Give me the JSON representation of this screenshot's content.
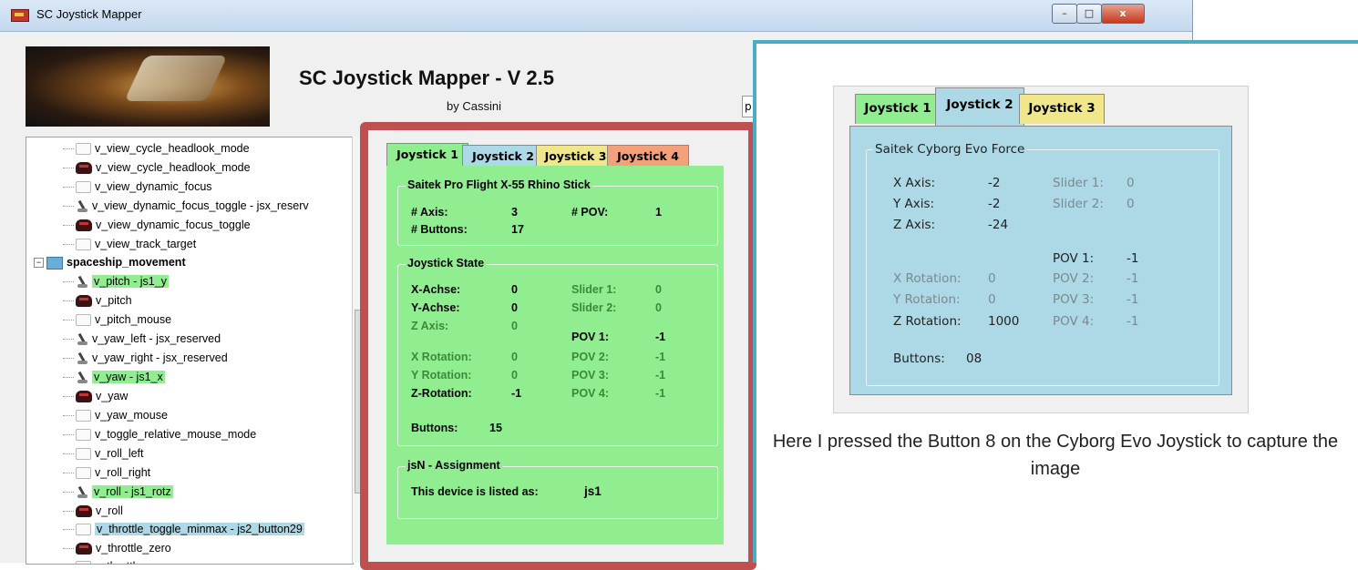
{
  "window": {
    "title": "SC Joystick Mapper",
    "controls": {
      "minimize": "–",
      "maximize": "□",
      "close": "x"
    }
  },
  "header": {
    "heading": "SC Joystick Mapper - V 2.5",
    "author": "by Cassini",
    "search_value": "p"
  },
  "tree": {
    "items": [
      {
        "label": "v_view_cycle_headlook_mode",
        "icon": "keyboard-icon"
      },
      {
        "label": "v_view_cycle_headlook_mode",
        "icon": "gamepad-icon"
      },
      {
        "label": "v_view_dynamic_focus",
        "icon": "keyboard-icon"
      },
      {
        "label": "v_view_dynamic_focus_toggle - jsx_reserv",
        "icon": "joystick-icon"
      },
      {
        "label": "v_view_dynamic_focus_toggle",
        "icon": "gamepad-icon"
      },
      {
        "label": "v_view_track_target",
        "icon": "keyboard-icon"
      },
      {
        "label": "spaceship_movement",
        "icon": "folder-icon"
      },
      {
        "label": "v_pitch - js1_y",
        "icon": "joystick-icon"
      },
      {
        "label": "v_pitch",
        "icon": "gamepad-icon"
      },
      {
        "label": "v_pitch_mouse",
        "icon": "keyboard-icon"
      },
      {
        "label": "v_yaw_left - jsx_reserved",
        "icon": "joystick-icon"
      },
      {
        "label": "v_yaw_right - jsx_reserved",
        "icon": "joystick-icon"
      },
      {
        "label": "v_yaw - js1_x",
        "icon": "joystick-icon"
      },
      {
        "label": "v_yaw",
        "icon": "gamepad-icon"
      },
      {
        "label": "v_yaw_mouse",
        "icon": "keyboard-icon"
      },
      {
        "label": "v_toggle_relative_mouse_mode",
        "icon": "keyboard-icon"
      },
      {
        "label": "v_roll_left",
        "icon": "keyboard-icon"
      },
      {
        "label": "v_roll_right",
        "icon": "keyboard-icon"
      },
      {
        "label": "v_roll - js1_rotz",
        "icon": "joystick-icon"
      },
      {
        "label": "v_roll",
        "icon": "gamepad-icon"
      },
      {
        "label": "v_throttle_toggle_minmax - js2_button29",
        "icon": "keyboard-icon"
      },
      {
        "label": "v_throttle_zero",
        "icon": "gamepad-icon"
      },
      {
        "label": "v_throttle_zero",
        "icon": "keyboard-icon"
      }
    ],
    "expander": "−"
  },
  "panel": {
    "tabs": [
      "Joystick 1",
      "Joystick 2",
      "Joystick 3",
      "Joystick 4"
    ],
    "tab_colors": [
      "#90ee90",
      "#add8e6",
      "#f0e68c",
      "#f4a07a"
    ],
    "device_group": {
      "title": "Saitek Pro Flight X-55 Rhino Stick",
      "axis_label": "# Axis:",
      "axis_value": "3",
      "pov_label": "# POV:",
      "pov_value": "1",
      "buttons_label": "# Buttons:",
      "buttons_value": "17"
    },
    "state_group": {
      "title": "Joystick State",
      "x_label": "X-Achse:",
      "x_value": "0",
      "y_label": "Y-Achse:",
      "y_value": "0",
      "z_label": "Z Axis:",
      "z_value": "0",
      "xrot_label": "X Rotation:",
      "xrot_value": "0",
      "yrot_label": "Y Rotation:",
      "yrot_value": "0",
      "zrot_label": "Z-Rotation:",
      "zrot_value": "-1",
      "slider1_label": "Slider 1:",
      "slider1_value": "0",
      "slider2_label": "Slider 2:",
      "slider2_value": "0",
      "pov1_label": "POV 1:",
      "pov1_value": "-1",
      "pov2_label": "POV 2:",
      "pov2_value": "-1",
      "pov3_label": "POV 3:",
      "pov3_value": "-1",
      "pov4_label": "POV 4:",
      "pov4_value": "-1",
      "buttons_label": "Buttons:",
      "buttons_value": "15"
    },
    "assign_group": {
      "title": "jsN - Assignment",
      "label": "This device is listed as:",
      "value": "js1"
    }
  },
  "overlay": {
    "tabs": [
      "Joystick 1",
      "Joystick 2",
      "Joystick 3"
    ],
    "device": "Saitek Cyborg Evo Force",
    "x_label": "X Axis:",
    "x_value": "-2",
    "y_label": "Y Axis:",
    "y_value": "-2",
    "z_label": "Z Axis:",
    "z_value": "-24",
    "slider1_label": "Slider 1:",
    "slider1_value": "0",
    "slider2_label": "Slider 2:",
    "slider2_value": "0",
    "pov1_label": "POV 1:",
    "pov1_value": "-1",
    "pov2_label": "POV 2:",
    "pov2_value": "-1",
    "pov3_label": "POV 3:",
    "pov3_value": "-1",
    "pov4_label": "POV 4:",
    "pov4_value": "-1",
    "xrot_label": "X Rotation:",
    "xrot_value": "0",
    "yrot_label": "Y Rotation:",
    "yrot_value": "0",
    "zrot_label": "Z Rotation:",
    "zrot_value": "1000",
    "buttons_label": "Buttons:",
    "buttons_value": "08",
    "caption": "Here I pressed the Button 8 on the Cyborg Evo Joystick to capture the image"
  }
}
